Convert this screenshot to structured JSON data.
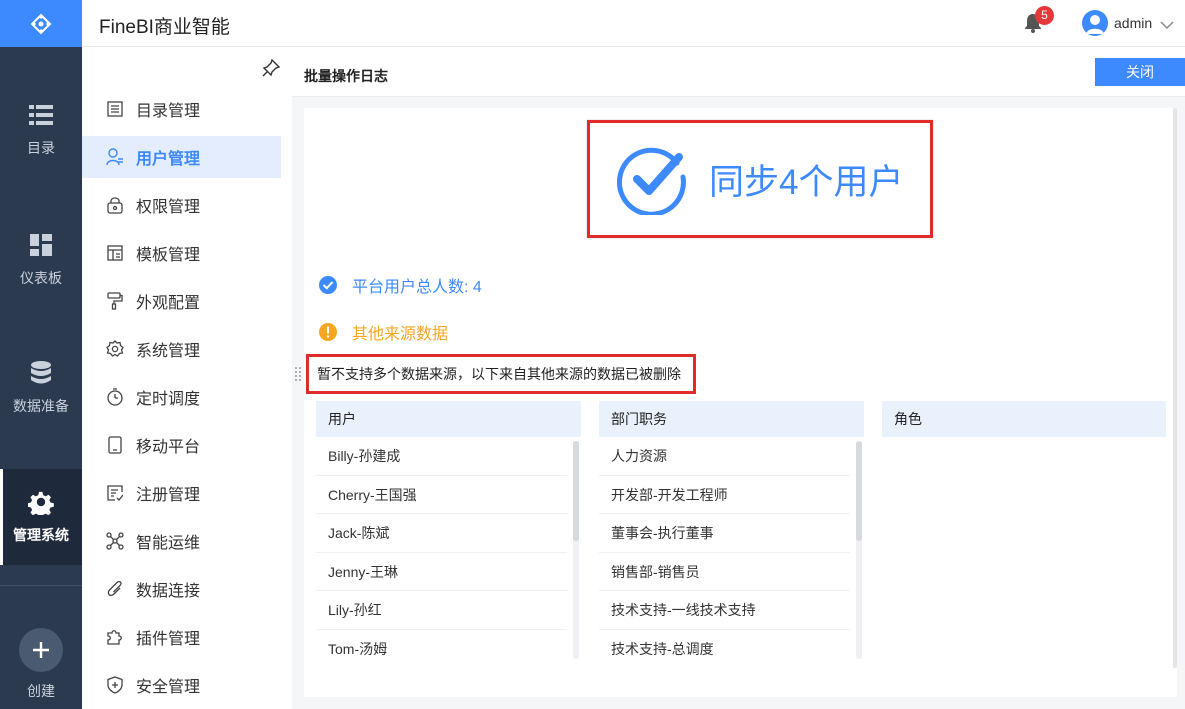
{
  "header": {
    "app_title": "FineBI商业智能",
    "notification_count": "5",
    "username": "admin"
  },
  "rail": {
    "items": [
      {
        "label": "目录",
        "icon": "list-icon"
      },
      {
        "label": "仪表板",
        "icon": "dashboard-icon"
      },
      {
        "label": "数据准备",
        "icon": "database-icon"
      },
      {
        "label": "管理系统",
        "icon": "gear-icon",
        "active": true
      }
    ],
    "create_label": "创建"
  },
  "menu": {
    "items": [
      {
        "label": "目录管理",
        "icon": "catalog-icon"
      },
      {
        "label": "用户管理",
        "icon": "user-icon",
        "active": true
      },
      {
        "label": "权限管理",
        "icon": "lock-icon"
      },
      {
        "label": "模板管理",
        "icon": "template-icon"
      },
      {
        "label": "外观配置",
        "icon": "paint-roller-icon"
      },
      {
        "label": "系统管理",
        "icon": "gear-icon"
      },
      {
        "label": "定时调度",
        "icon": "timer-icon"
      },
      {
        "label": "移动平台",
        "icon": "mobile-icon"
      },
      {
        "label": "注册管理",
        "icon": "register-icon"
      },
      {
        "label": "智能运维",
        "icon": "network-icon"
      },
      {
        "label": "数据连接",
        "icon": "paperclip-icon"
      },
      {
        "label": "插件管理",
        "icon": "puzzle-icon"
      },
      {
        "label": "安全管理",
        "icon": "shield-icon"
      }
    ]
  },
  "content": {
    "title": "批量操作日志",
    "close_label": "关闭",
    "result_text": "同步4个用户",
    "total_users_text": "平台用户总人数: 4",
    "other_sources_text": "其他来源数据",
    "warning_text": "暂不支持多个数据来源，以下来自其他来源的数据已被删除",
    "columns": [
      {
        "header": "用户",
        "rows": [
          "Billy-孙建成",
          "Cherry-王国强",
          "Jack-陈斌",
          "Jenny-王琳",
          "Lily-孙红",
          "Tom-汤姆"
        ]
      },
      {
        "header": "部门职务",
        "rows": [
          "人力资源",
          "开发部-开发工程师",
          "董事会-执行董事",
          "销售部-销售员",
          "技术支持-一线技术支持",
          "技术支持-总调度"
        ]
      },
      {
        "header": "角色",
        "rows": []
      }
    ]
  },
  "colors": {
    "accent": "#3d8aff",
    "rail_bg": "#2b3a4f",
    "warning": "#f5a623",
    "highlight_border": "#e02b2b",
    "badge": "#e5383b"
  }
}
